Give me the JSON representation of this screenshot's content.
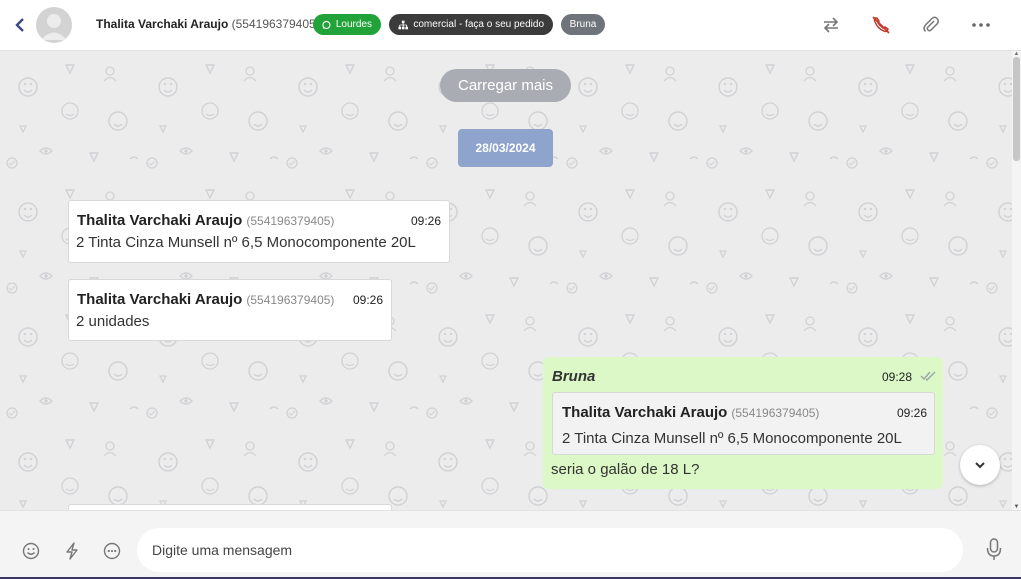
{
  "header": {
    "contact_name": "Thalita Varchaki Araujo",
    "contact_phone": "(554196379405)",
    "tags": {
      "channel": "Lourdes",
      "queue": "comercial - faça o seu pedido",
      "agent": "Bruna"
    },
    "icons": {
      "back": "chevron-left-icon",
      "transfer": "transfer-arrows-icon",
      "end_call": "phone-off-icon",
      "attach": "paperclip-icon",
      "more": "more-horizontal-icon"
    }
  },
  "chat": {
    "load_more_label": "Carregar mais",
    "date_label": "28/03/2024",
    "messages": [
      {
        "sender": "Thalita Varchaki Araujo",
        "phone": "(554196379405)",
        "time": "09:26",
        "text": "2 Tinta Cinza Munsell nº 6,5 Monocomponente 20L"
      },
      {
        "sender": "Thalita Varchaki Araujo",
        "phone": "(554196379405)",
        "time": "09:26",
        "text": "2 unidades"
      }
    ],
    "outgoing": {
      "sender": "Bruna",
      "time": "09:28",
      "status_icon": "double-check-icon",
      "quoted": {
        "sender": "Thalita Varchaki Araujo",
        "phone": "(554196379405)",
        "time": "09:26",
        "text": "2 Tinta Cinza Munsell nº 6,5 Monocomponente 20L"
      },
      "text": "seria o galão de 18 L?"
    }
  },
  "footer": {
    "input_placeholder": "Digite uma mensagem",
    "icons": [
      "emoji-icon",
      "lightning-icon",
      "quick-reply-icon",
      "microphone-icon"
    ]
  },
  "colors": {
    "green_tag": "#22a33a",
    "dark_tag": "#3b3b3b",
    "grey_tag": "#6f747a",
    "date_chip": "#8fa4cd",
    "outgoing_bubble": "#dcf8c6",
    "end_call_red": "#c0392b"
  }
}
